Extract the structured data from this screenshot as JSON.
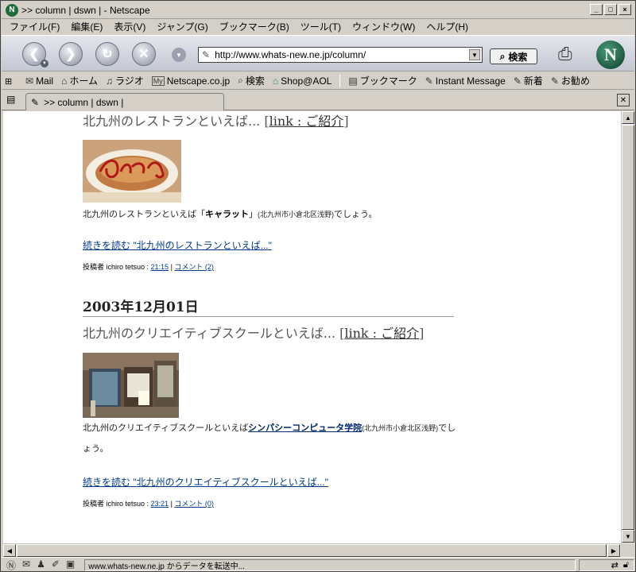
{
  "window": {
    "title": ">> column | dswn | - Netscape",
    "minimize": "_",
    "maximize": "□",
    "close": "×"
  },
  "menu": [
    "ファイル(F)",
    "編集(E)",
    "表示(V)",
    "ジャンプ(G)",
    "ブックマーク(B)",
    "ツール(T)",
    "ウィンドウ(W)",
    "ヘルプ(H)"
  ],
  "navbar": {
    "url": "http://www.whats-new.ne.jp/column/",
    "search_label": "検索"
  },
  "personal_toolbar": [
    {
      "icon": "mail-icon",
      "glyph": "✉",
      "label": "Mail"
    },
    {
      "icon": "home-icon",
      "glyph": "⌂",
      "label": "ホーム"
    },
    {
      "icon": "radio-icon",
      "glyph": "♫",
      "label": "ラジオ"
    },
    {
      "icon": "my-netscape-icon",
      "glyph": "My",
      "label": "Netscape.co.jp"
    },
    {
      "icon": "search-icon",
      "glyph": "⌕",
      "label": "検索"
    },
    {
      "icon": "shop-icon",
      "glyph": "⌂",
      "label": "Shop@AOL"
    },
    {
      "icon": "bookmark-icon",
      "glyph": "▤",
      "label": "ブックマーク"
    },
    {
      "icon": "link-icon",
      "glyph": "✎",
      "label": "Instant Message"
    },
    {
      "icon": "link-icon",
      "glyph": "✎",
      "label": "新着"
    },
    {
      "icon": "link-icon",
      "glyph": "✎",
      "label": "お勧め"
    }
  ],
  "tab": {
    "label": ">> column | dswn |"
  },
  "posts": {
    "first": {
      "heading": "北九州のレストランといえば... ",
      "heading_link": "link : ご紹介",
      "body_pre": "北九州のレストランといえば「",
      "body_bold": "キャラット",
      "body_post": "」",
      "body_small": "(北九州市小倉北区浅野)",
      "body_end": "でしょう。",
      "readmore": "続きを読む \"北九州のレストランといえば...\"",
      "footer_author": "投稿者 ichiro tetsuo : ",
      "footer_time": "21:15",
      "footer_sep": " | ",
      "footer_comment": "コメント (2)"
    },
    "second": {
      "date": "2003年12月01日",
      "heading": "北九州のクリエイティブスクールといえば... ",
      "heading_link": "link : ご紹介",
      "body_pre": "北九州のクリエイティブスクールといえば",
      "body_bold": "シンパシーコンピュータ学院",
      "body_small": "(北九州市小倉北区浅野)",
      "body_end": "でしょう。",
      "readmore": "続きを読む \"北九州のクリエイティブスクールといえば...\"",
      "footer_author": "投稿者 ichiro tetsuo : ",
      "footer_time": "23:21",
      "footer_sep": " | ",
      "footer_comment": "コメント (0)"
    }
  },
  "status": {
    "text": "www.whats-new.ne.jp からデータを転送中..."
  },
  "colors": {
    "link": "#003a8a",
    "chrome": "#d4d0c8"
  }
}
